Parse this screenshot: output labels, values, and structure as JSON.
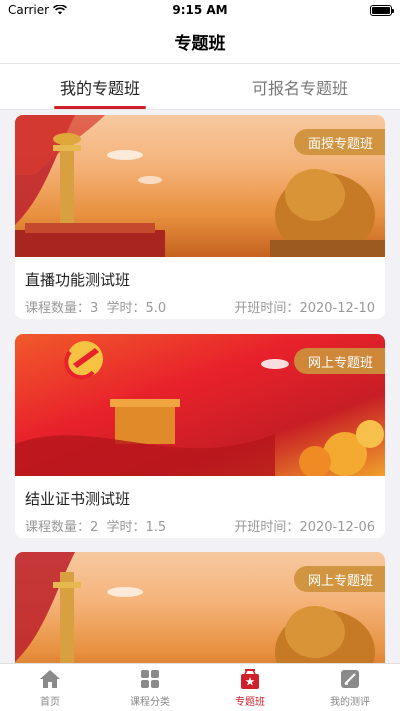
{
  "status": {
    "carrier": "Carrier",
    "time": "9:15 AM"
  },
  "nav": {
    "title": "专题班"
  },
  "tabs": [
    {
      "label": "我的专题班",
      "active": true
    },
    {
      "label": "可报名专题班",
      "active": false
    }
  ],
  "cards": [
    {
      "badge": "面授专题班",
      "title": "直播功能测试班",
      "course_count_label": "课程数量：",
      "course_count": "3",
      "hours_label": "学时：",
      "hours": "5.0",
      "start_label": "开班时间：",
      "start_date": "2020-12-10",
      "banner": "tiananmen-huabiao-lion"
    },
    {
      "badge": "网上专题班",
      "title": "结业证书测试班",
      "course_count_label": "课程数量：",
      "course_count": "2",
      "hours_label": "学时：",
      "hours": "1.5",
      "start_label": "开班时间：",
      "start_date": "2020-12-06",
      "banner": "party-emblem-great-wall"
    },
    {
      "badge": "网上专题班",
      "banner": "tiananmen-huabiao-lion"
    }
  ],
  "tabbar": [
    {
      "label": "首页",
      "icon": "home-icon",
      "active": false
    },
    {
      "label": "课程分类",
      "icon": "grid-icon",
      "active": false
    },
    {
      "label": "专题班",
      "icon": "special-class-icon",
      "active": true
    },
    {
      "label": "我的测评",
      "icon": "assessment-icon",
      "active": false
    }
  ],
  "colors": {
    "accent": "#d0202a",
    "badge": "#cd913c"
  }
}
